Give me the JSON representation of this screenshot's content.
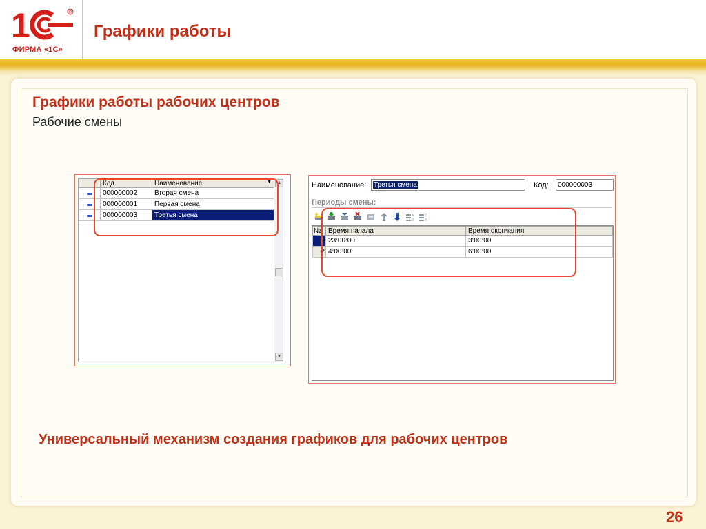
{
  "header": {
    "logo_text": "ФИРМА «1С»",
    "title": "Графики работы"
  },
  "section": {
    "title": "Графики работы рабочих центров",
    "subtitle": "Рабочие смены"
  },
  "list_window": {
    "columns": [
      "Код",
      "Наименование"
    ],
    "rows": [
      {
        "code": "000000002",
        "name": "Вторая смена",
        "selected": false
      },
      {
        "code": "000000001",
        "name": "Первая смена",
        "selected": false
      },
      {
        "code": "000000003",
        "name": "Третья смена",
        "selected": true
      }
    ]
  },
  "form_window": {
    "name_label": "Наименование:",
    "name_value": "Третья смена",
    "code_label": "Код:",
    "code_value": "000000003",
    "group_label": "Периоды смены:",
    "toolbar_icons": [
      "add-icon",
      "add-copy-icon",
      "edit-icon",
      "delete-icon",
      "end-edit-icon",
      "move-up-icon",
      "move-down-icon",
      "sort-asc-icon",
      "sort-desc-icon"
    ],
    "columns": [
      "№",
      "Время начала",
      "Время окончания"
    ],
    "rows": [
      {
        "n": "1",
        "start": "23:00:00",
        "end": "3:00:00"
      },
      {
        "n": "2",
        "start": "4:00:00",
        "end": "6:00:00"
      }
    ]
  },
  "bottom_text": "Универсальный механизм создания графиков для рабочих центров",
  "page_number": "26",
  "colors": {
    "accent": "#c0311a",
    "band": "#e7b21e",
    "highlight": "#e8492a",
    "selection": "#0a1e7a"
  }
}
